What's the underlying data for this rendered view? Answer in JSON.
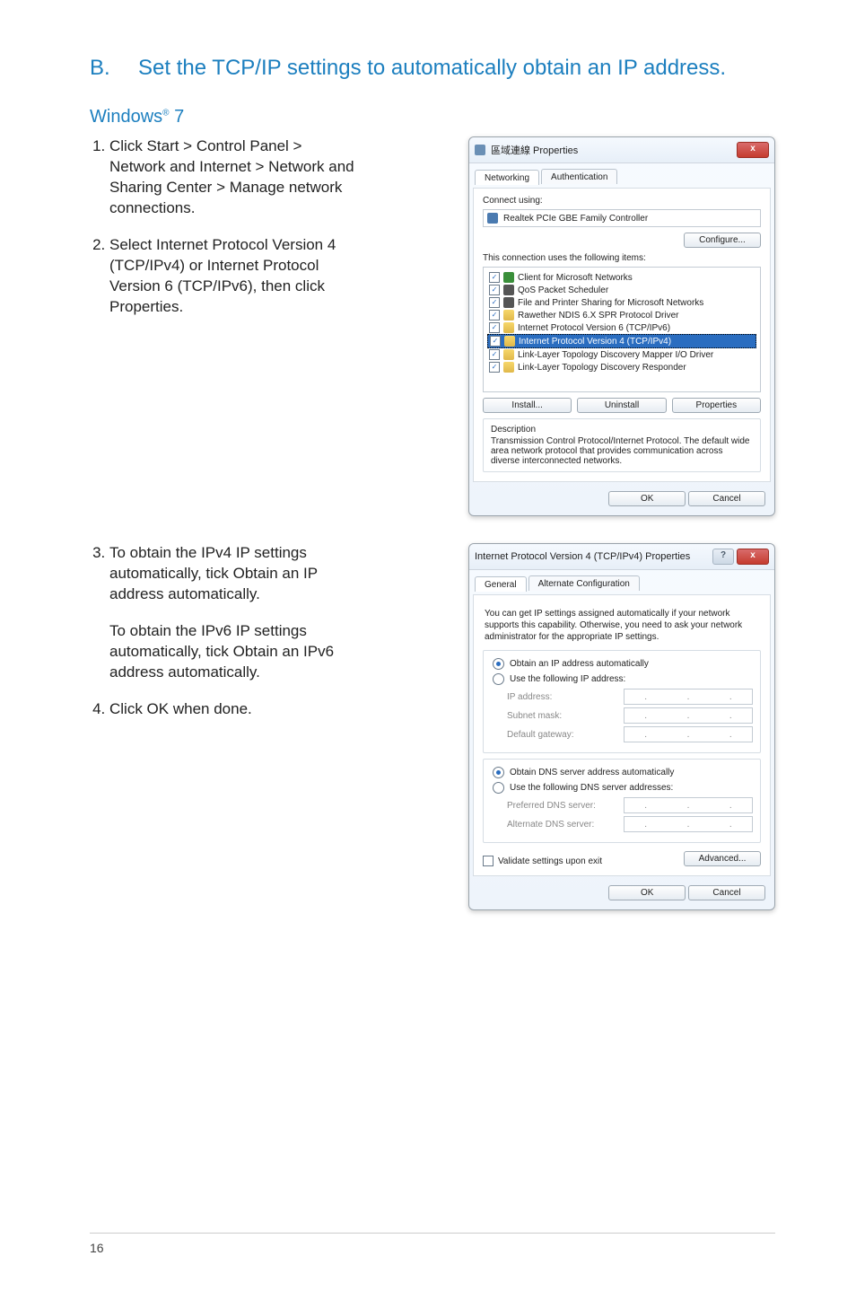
{
  "section": {
    "letter": "B.",
    "title": "Set the TCP/IP settings to automatically obtain an IP address."
  },
  "subheading": "Windows",
  "subheading_suffix": " 7",
  "steps_block1": [
    "Click Start > Control Panel > Network and Internet > Network and Sharing Center > Manage network connections.",
    "Select Internet Protocol Version 4 (TCP/IPv4) or Internet Protocol Version 6 (TCP/IPv6), then click Properties."
  ],
  "steps_block2_start": 3,
  "step3": "To obtain the IPv4 IP settings automatically, tick Obtain an IP address automatically.",
  "step3b": "To obtain the IPv6 IP settings automatically, tick Obtain an IPv6 address automatically.",
  "step4": "Click OK when done.",
  "dlg1": {
    "title": "區域連線 Properties",
    "tabs": [
      "Networking",
      "Authentication"
    ],
    "connect_using_label": "Connect using:",
    "adapter": "Realtek PCIe GBE Family Controller",
    "configure": "Configure...",
    "uses_label": "This connection uses the following items:",
    "items": [
      "Client for Microsoft Networks",
      "QoS Packet Scheduler",
      "File and Printer Sharing for Microsoft Networks",
      "Rawether NDIS 6.X SPR Protocol Driver",
      "Internet Protocol Version 6 (TCP/IPv6)",
      "Internet Protocol Version 4 (TCP/IPv4)",
      "Link-Layer Topology Discovery Mapper I/O Driver",
      "Link-Layer Topology Discovery Responder"
    ],
    "install": "Install...",
    "uninstall": "Uninstall",
    "properties": "Properties",
    "desc_label": "Description",
    "desc": "Transmission Control Protocol/Internet Protocol. The default wide area network protocol that provides communication across diverse interconnected networks.",
    "ok": "OK",
    "cancel": "Cancel"
  },
  "dlg2": {
    "title": "Internet Protocol Version 4 (TCP/IPv4) Properties",
    "tabs": [
      "General",
      "Alternate Configuration"
    ],
    "info": "You can get IP settings assigned automatically if your network supports this capability. Otherwise, you need to ask your network administrator for the appropriate IP settings.",
    "r1": "Obtain an IP address automatically",
    "r2": "Use the following IP address:",
    "ip_label": "IP address:",
    "subnet_label": "Subnet mask:",
    "gateway_label": "Default gateway:",
    "r3": "Obtain DNS server address automatically",
    "r4": "Use the following DNS server addresses:",
    "pref_dns": "Preferred DNS server:",
    "alt_dns": "Alternate DNS server:",
    "validate": "Validate settings upon exit",
    "advanced": "Advanced...",
    "ok": "OK",
    "cancel": "Cancel"
  },
  "page_number": "16"
}
